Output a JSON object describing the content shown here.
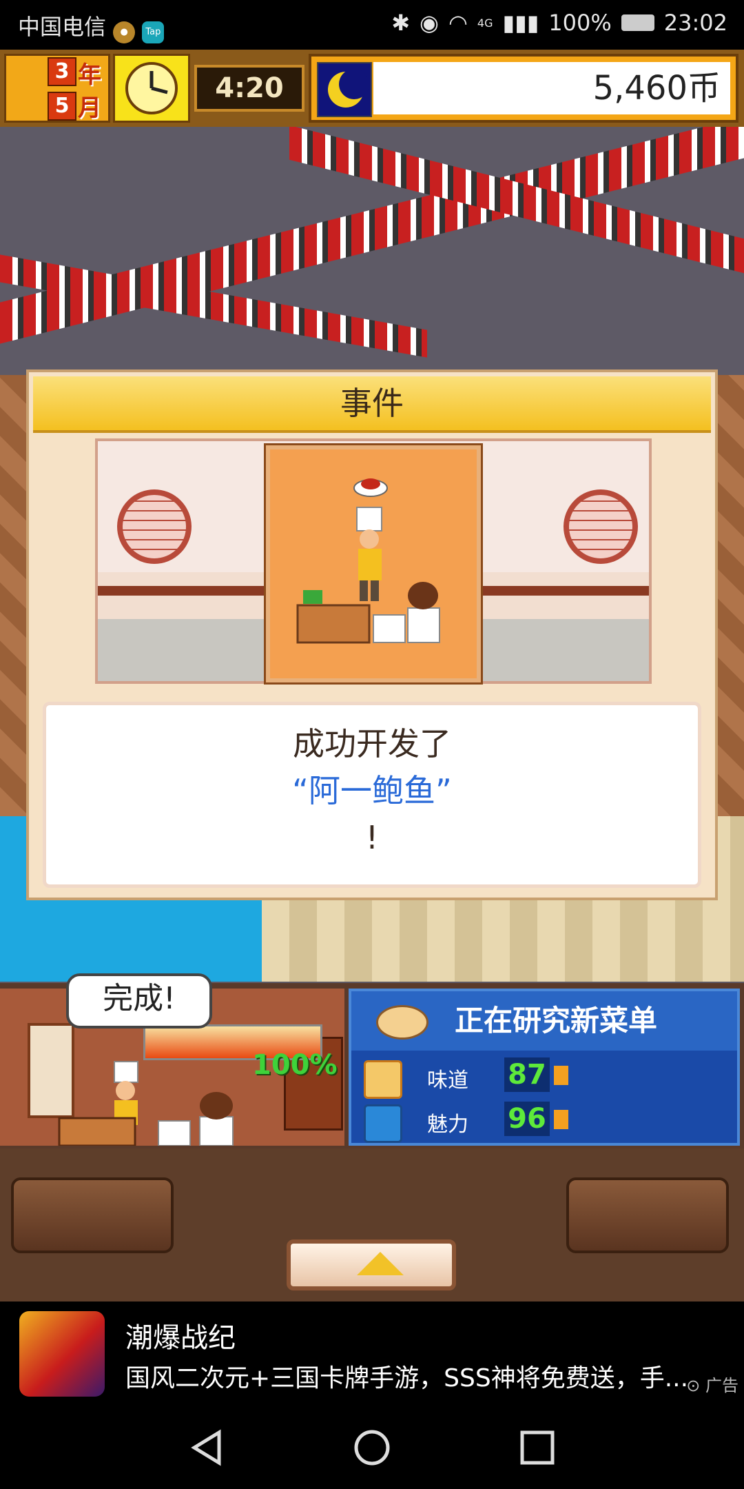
{
  "status_bar": {
    "carrier": "中国电信",
    "app_badge": "Tap",
    "network": "4G",
    "battery": "100%",
    "time": "23:02"
  },
  "hud": {
    "year_number": "3",
    "year_label": "年",
    "month_number": "5",
    "month_label": "月",
    "play_time": "4:20",
    "coins": "5,460币"
  },
  "event_dialog": {
    "title": "事件",
    "message_line1": "成功开发了",
    "dish_name": "“阿一鲍鱼”",
    "message_line3": "!"
  },
  "kitchen": {
    "bubble_text": "完成!",
    "progress_percent": "100%",
    "progress_fraction": 1.0
  },
  "research": {
    "title": "正在研究新菜单",
    "stats": [
      {
        "label": "味道",
        "value": "87",
        "fraction": 0.08
      },
      {
        "label": "魅力",
        "value": "96",
        "fraction": 0.08
      }
    ]
  },
  "ad": {
    "title": "潮爆战纪",
    "body": "国风二次元+三国卡牌手游，SSS神将免费送，手...",
    "tag": "广告"
  },
  "colors": {
    "hud_gold": "#f4a616",
    "dialog_title": "#f4c020",
    "dish_highlight": "#2a6ad8",
    "research_blue": "#1a4aa8",
    "stat_green": "#5eea3a",
    "progress_orange": "#e84a12"
  }
}
